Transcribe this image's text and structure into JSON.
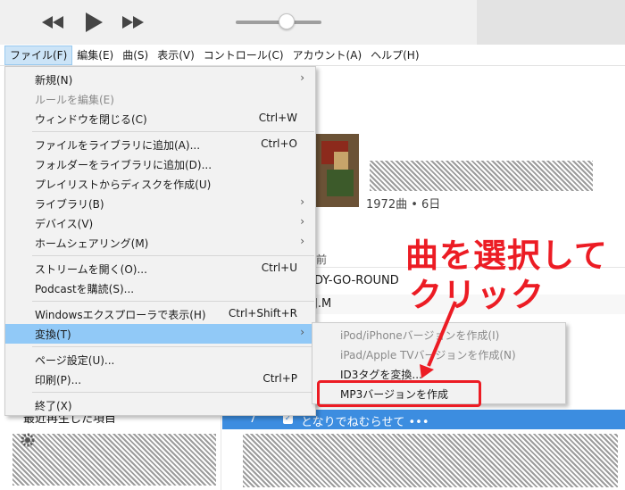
{
  "menubar": {
    "items": [
      {
        "label": "ファイル(F)"
      },
      {
        "label": "編集(E)"
      },
      {
        "label": "曲(S)"
      },
      {
        "label": "表示(V)"
      },
      {
        "label": "コントロール(C)"
      },
      {
        "label": "アカウント(A)"
      },
      {
        "label": "ヘルプ(H)"
      }
    ]
  },
  "file_menu": {
    "items": [
      {
        "label": "新規(N)",
        "shortcut": "",
        "submenu": true
      },
      {
        "label": "ルールを編集(E)",
        "shortcut": "",
        "disabled": true
      },
      {
        "label": "ウィンドウを閉じる(C)",
        "shortcut": "Ctrl+W"
      },
      {
        "label": "ファイルをライブラリに追加(A)...",
        "shortcut": "Ctrl+O"
      },
      {
        "label": "フォルダーをライブラリに追加(D)...",
        "shortcut": ""
      },
      {
        "label": "プレイリストからディスクを作成(U)",
        "shortcut": ""
      },
      {
        "label": "ライブラリ(B)",
        "shortcut": "",
        "submenu": true
      },
      {
        "label": "デバイス(V)",
        "shortcut": "",
        "submenu": true
      },
      {
        "label": "ホームシェアリング(M)",
        "shortcut": "",
        "submenu": true
      },
      {
        "label": "ストリームを開く(O)...",
        "shortcut": "Ctrl+U"
      },
      {
        "label": "Podcastを購読(S)...",
        "shortcut": ""
      },
      {
        "label": "Windowsエクスプローラで表示(H)",
        "shortcut": "Ctrl+Shift+R"
      },
      {
        "label": "変換(T)",
        "shortcut": "",
        "submenu": true,
        "highlighted": true
      },
      {
        "label": "ページ設定(U)...",
        "shortcut": ""
      },
      {
        "label": "印刷(P)...",
        "shortcut": "Ctrl+P"
      },
      {
        "label": "終了(X)",
        "shortcut": ""
      }
    ]
  },
  "convert_submenu": {
    "items": [
      {
        "label": "iPod/iPhoneバージョンを作成(I)",
        "disabled": true
      },
      {
        "label": "iPad/Apple TVバージョンを作成(N)",
        "disabled": true
      },
      {
        "label": "ID3タグを変換...",
        "disabled": false
      },
      {
        "label": "MP3バージョンを作成",
        "disabled": false
      }
    ]
  },
  "library": {
    "album_meta": "1972曲 • 6日",
    "column_name": "前",
    "rows": [
      {
        "title_fragment": "DY-GO-ROUND"
      },
      {
        "title_fragment": "J.M"
      }
    ],
    "selected_row": {
      "number": "7",
      "title": "となりでねむらせて",
      "more": "•••"
    },
    "sidebar_item": "最近再生した項目"
  },
  "annotation": {
    "line1": "曲を選択して",
    "line2": "クリック",
    "color": "#ec1c24"
  },
  "icons": {
    "prev": "rewind-icon",
    "play": "play-icon",
    "next": "fast-forward-icon",
    "submenu": "chevron-right-icon",
    "gear": "gear-icon"
  },
  "colors": {
    "menu_highlight": "#91c9f7",
    "selection": "#3c8de0",
    "menubar_active": "#cce4f7"
  }
}
